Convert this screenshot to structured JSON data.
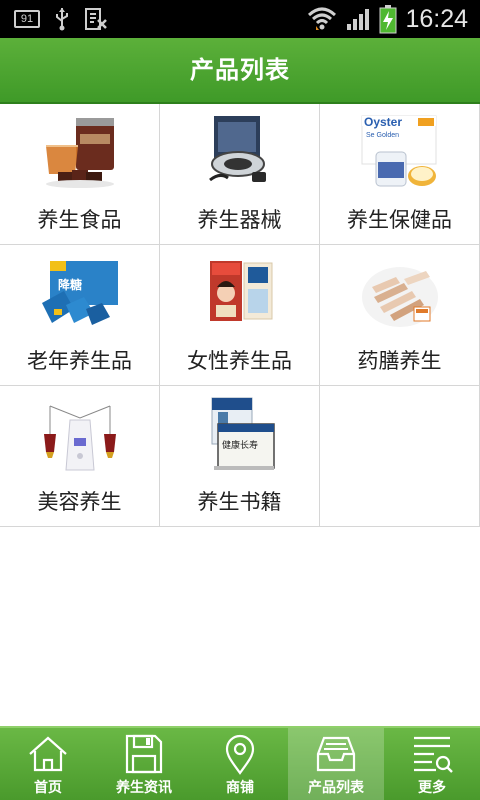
{
  "status_bar": {
    "notification_badge": "91",
    "time": "16:24"
  },
  "header": {
    "title": "产品列表"
  },
  "categories": [
    {
      "label": "养生食品",
      "icon": "herbal-tea-product-image"
    },
    {
      "label": "养生器械",
      "icon": "health-device-product-image"
    },
    {
      "label": "养生保健品",
      "icon": "oyster-supplement-product-image"
    },
    {
      "label": "老年养生品",
      "icon": "elderly-health-product-image"
    },
    {
      "label": "女性养生品",
      "icon": "women-health-product-image"
    },
    {
      "label": "药膳养生",
      "icon": "medicinal-food-product-image"
    },
    {
      "label": "美容养生",
      "icon": "beauty-device-product-image"
    },
    {
      "label": "养生书籍",
      "icon": "health-book-product-image"
    }
  ],
  "bottom_nav": [
    {
      "label": "首页",
      "icon": "home-icon",
      "active": false
    },
    {
      "label": "养生资讯",
      "icon": "save-icon",
      "active": false
    },
    {
      "label": "商铺",
      "icon": "location-pin-icon",
      "active": false
    },
    {
      "label": "产品列表",
      "icon": "inbox-tray-icon",
      "active": true
    },
    {
      "label": "更多",
      "icon": "list-search-icon",
      "active": false
    }
  ],
  "colors": {
    "header_green": "#4aa22f",
    "nav_green": "#5aab3a",
    "grid_line": "#d6d6d6"
  }
}
